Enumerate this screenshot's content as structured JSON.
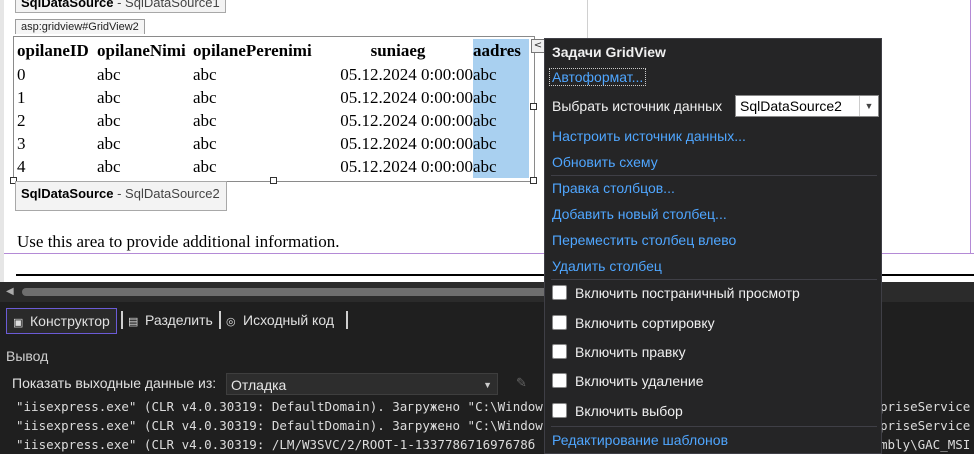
{
  "designer": {
    "sqlds_top": {
      "bold": "SqlDataSource",
      "rest": " - SqlDataSource1"
    },
    "gridview_tag": "asp:gridview#GridView2",
    "columns": [
      "opilaneID",
      "opilaneNimi",
      "opilanePerenimi",
      "suniaeg",
      "aadres"
    ],
    "rows": [
      [
        "0",
        "abc",
        "abc",
        "05.12.2024 0:00:00",
        "abc"
      ],
      [
        "1",
        "abc",
        "abc",
        "05.12.2024 0:00:00",
        "abc"
      ],
      [
        "2",
        "abc",
        "abc",
        "05.12.2024 0:00:00",
        "abc"
      ],
      [
        "3",
        "abc",
        "abc",
        "05.12.2024 0:00:00",
        "abc"
      ],
      [
        "4",
        "abc",
        "abc",
        "05.12.2024 0:00:00",
        "abc"
      ]
    ],
    "sqlds_bottom": {
      "bold": "SqlDataSource",
      "rest": " - SqlDataSource2"
    },
    "smart_tag_glyph": "<",
    "info_text": "Use this area to provide additional information."
  },
  "view_tabs": [
    {
      "label": "Конструктор",
      "icon": "design-icon",
      "active": true
    },
    {
      "label": "Разделить",
      "icon": "split-icon",
      "active": false
    },
    {
      "label": "Исходный код",
      "icon": "source-code-icon",
      "active": false
    }
  ],
  "output": {
    "title": "Вывод",
    "show_from_label": "Показать выходные данные из:",
    "show_from_value": "Отладка",
    "log_lines": [
      "\"iisexpress.exe\" (CLR v4.0.30319: DefaultDomain). Загружено \"C:\\Window",
      "\"iisexpress.exe\" (CLR v4.0.30319: DefaultDomain). Загружено \"C:\\Window",
      "\"iisexpress.exe\" (CLR v4.0.30319: /LM/W3SVC/2/ROOT-1-133778671697678б"
    ],
    "log_right": [
      "priseService",
      "priseService",
      "mbly\\GAC_MSI"
    ]
  },
  "smart_panel": {
    "title": "Задачи GridView",
    "autoformat": "Автоформат...",
    "choose_source_label": "Выбрать источник данных",
    "choose_source_value": "SqlDataSource2",
    "configure_source": "Настроить источник данных...",
    "refresh_schema": "Обновить схему",
    "edit_columns": "Правка столбцов...",
    "add_column": "Добавить новый столбец...",
    "move_column_left": "Переместить столбец влево",
    "remove_column": "Удалить столбец",
    "checkboxes": [
      "Включить постраничный просмотр",
      "Включить сортировку",
      "Включить правку",
      "Включить удаление",
      "Включить выбор"
    ],
    "edit_templates": "Редактирование шаблонов"
  }
}
